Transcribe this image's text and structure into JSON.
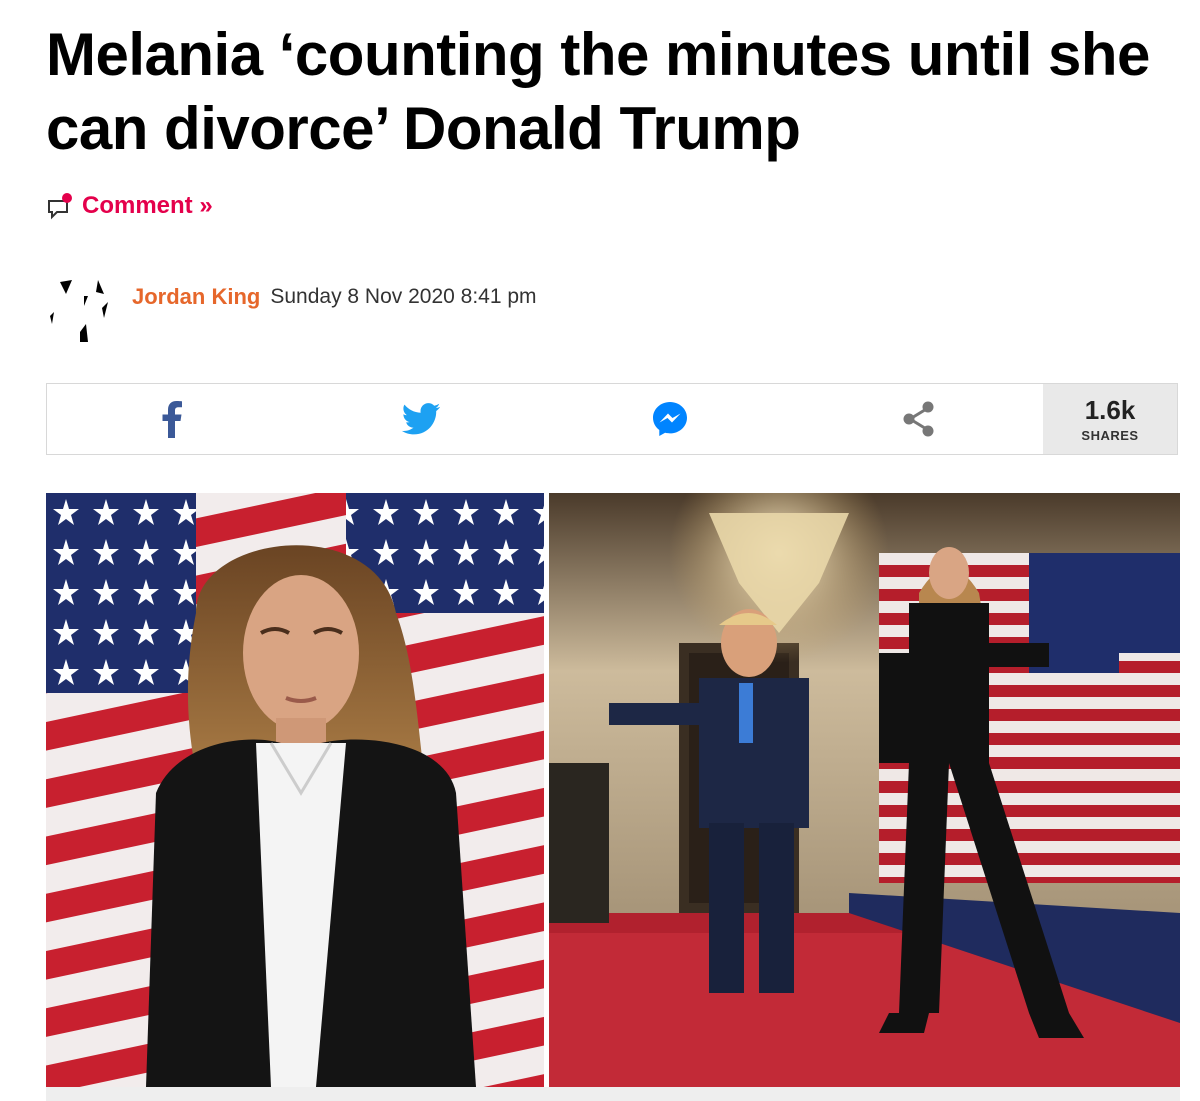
{
  "article": {
    "headline": "Melania ‘counting the minutes until she can divorce’ Donald Trump",
    "comment_label": "Comment »",
    "author": "Jordan King",
    "date": "Sunday 8 Nov 2020 8:41 pm"
  },
  "share": {
    "buttons": [
      {
        "icon": "facebook-icon",
        "color": "#3b5998"
      },
      {
        "icon": "twitter-icon",
        "color": "#1da1f2"
      },
      {
        "icon": "messenger-icon",
        "color": "#0084ff"
      },
      {
        "icon": "share-icon",
        "color": "#666666"
      }
    ],
    "count": "1.6k",
    "count_label": "SHARES"
  },
  "colors": {
    "accent_pink": "#e4004b",
    "author_orange": "#e6672b"
  }
}
